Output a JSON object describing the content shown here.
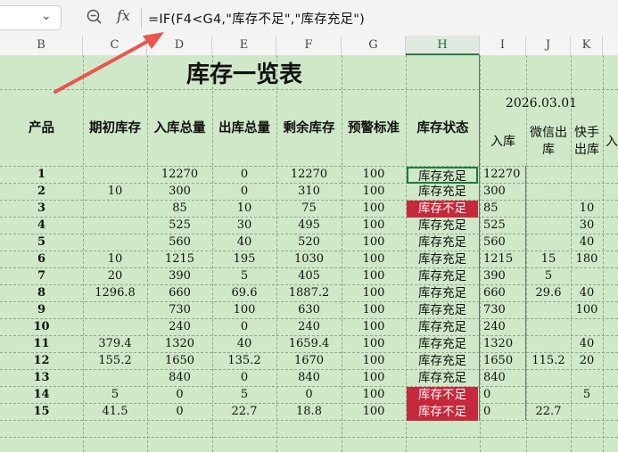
{
  "formula_bar": {
    "name_box": "",
    "fx_label": "fx",
    "formula": "=IF(F4<G4,\"库存不足\",\"库存充足\")"
  },
  "columns": [
    "B",
    "C",
    "D",
    "E",
    "F",
    "G",
    "H",
    "I",
    "J",
    "K"
  ],
  "title": "库存一览表",
  "date": "2026.03.01",
  "headers": {
    "product": "产品",
    "opening": "期初库存",
    "in_total": "入库总量",
    "out_total": "出库总量",
    "remaining": "剩余库存",
    "warning": "预警标准",
    "status": "库存状态",
    "in": "入库",
    "wechat": "微信出库",
    "kuaishou": "快手出库",
    "partial": "入"
  },
  "rows": [
    {
      "product": "1",
      "opening": "",
      "in_total": "12270",
      "out_total": "0",
      "remaining": "12270",
      "warning": "100",
      "status": "库存充足",
      "alert": false,
      "in": "12270",
      "wechat": "",
      "kuaishou": ""
    },
    {
      "product": "2",
      "opening": "10",
      "in_total": "300",
      "out_total": "0",
      "remaining": "310",
      "warning": "100",
      "status": "库存充足",
      "alert": false,
      "in": "300",
      "wechat": "",
      "kuaishou": ""
    },
    {
      "product": "3",
      "opening": "",
      "in_total": "85",
      "out_total": "10",
      "remaining": "75",
      "warning": "100",
      "status": "库存不足",
      "alert": true,
      "in": "85",
      "wechat": "",
      "kuaishou": "10"
    },
    {
      "product": "4",
      "opening": "",
      "in_total": "525",
      "out_total": "30",
      "remaining": "495",
      "warning": "100",
      "status": "库存充足",
      "alert": false,
      "in": "525",
      "wechat": "",
      "kuaishou": "30"
    },
    {
      "product": "5",
      "opening": "",
      "in_total": "560",
      "out_total": "40",
      "remaining": "520",
      "warning": "100",
      "status": "库存充足",
      "alert": false,
      "in": "560",
      "wechat": "",
      "kuaishou": "40"
    },
    {
      "product": "6",
      "opening": "10",
      "in_total": "1215",
      "out_total": "195",
      "remaining": "1030",
      "warning": "100",
      "status": "库存充足",
      "alert": false,
      "in": "1215",
      "wechat": "15",
      "kuaishou": "180"
    },
    {
      "product": "7",
      "opening": "20",
      "in_total": "390",
      "out_total": "5",
      "remaining": "405",
      "warning": "100",
      "status": "库存充足",
      "alert": false,
      "in": "390",
      "wechat": "5",
      "kuaishou": ""
    },
    {
      "product": "8",
      "opening": "1296.8",
      "in_total": "660",
      "out_total": "69.6",
      "remaining": "1887.2",
      "warning": "100",
      "status": "库存充足",
      "alert": false,
      "in": "660",
      "wechat": "29.6",
      "kuaishou": "40"
    },
    {
      "product": "9",
      "opening": "",
      "in_total": "730",
      "out_total": "100",
      "remaining": "630",
      "warning": "100",
      "status": "库存充足",
      "alert": false,
      "in": "730",
      "wechat": "",
      "kuaishou": "100"
    },
    {
      "product": "10",
      "opening": "",
      "in_total": "240",
      "out_total": "0",
      "remaining": "240",
      "warning": "100",
      "status": "库存充足",
      "alert": false,
      "in": "240",
      "wechat": "",
      "kuaishou": ""
    },
    {
      "product": "11",
      "opening": "379.4",
      "in_total": "1320",
      "out_total": "40",
      "remaining": "1659.4",
      "warning": "100",
      "status": "库存充足",
      "alert": false,
      "in": "1320",
      "wechat": "",
      "kuaishou": "40"
    },
    {
      "product": "12",
      "opening": "155.2",
      "in_total": "1650",
      "out_total": "135.2",
      "remaining": "1670",
      "warning": "100",
      "status": "库存充足",
      "alert": false,
      "in": "1650",
      "wechat": "115.2",
      "kuaishou": "20"
    },
    {
      "product": "13",
      "opening": "",
      "in_total": "840",
      "out_total": "0",
      "remaining": "840",
      "warning": "100",
      "status": "库存充足",
      "alert": false,
      "in": "840",
      "wechat": "",
      "kuaishou": ""
    },
    {
      "product": "14",
      "opening": "5",
      "in_total": "0",
      "out_total": "5",
      "remaining": "0",
      "warning": "100",
      "status": "库存不足",
      "alert": true,
      "in": "0",
      "wechat": "",
      "kuaishou": "5"
    },
    {
      "product": "15",
      "opening": "41.5",
      "in_total": "0",
      "out_total": "22.7",
      "remaining": "18.8",
      "warning": "100",
      "status": "库存不足",
      "alert": true,
      "in": "0",
      "wechat": "22.7",
      "kuaishou": ""
    }
  ],
  "colors": {
    "sheet_bg": "#cfe8c7",
    "alert_bg": "#c6293b",
    "selection": "#1f7a3e",
    "arrow": "#e8574f"
  },
  "icons": [
    "chevron-down-icon",
    "zoom-icon",
    "fx-icon",
    "annotation-arrow-icon"
  ]
}
